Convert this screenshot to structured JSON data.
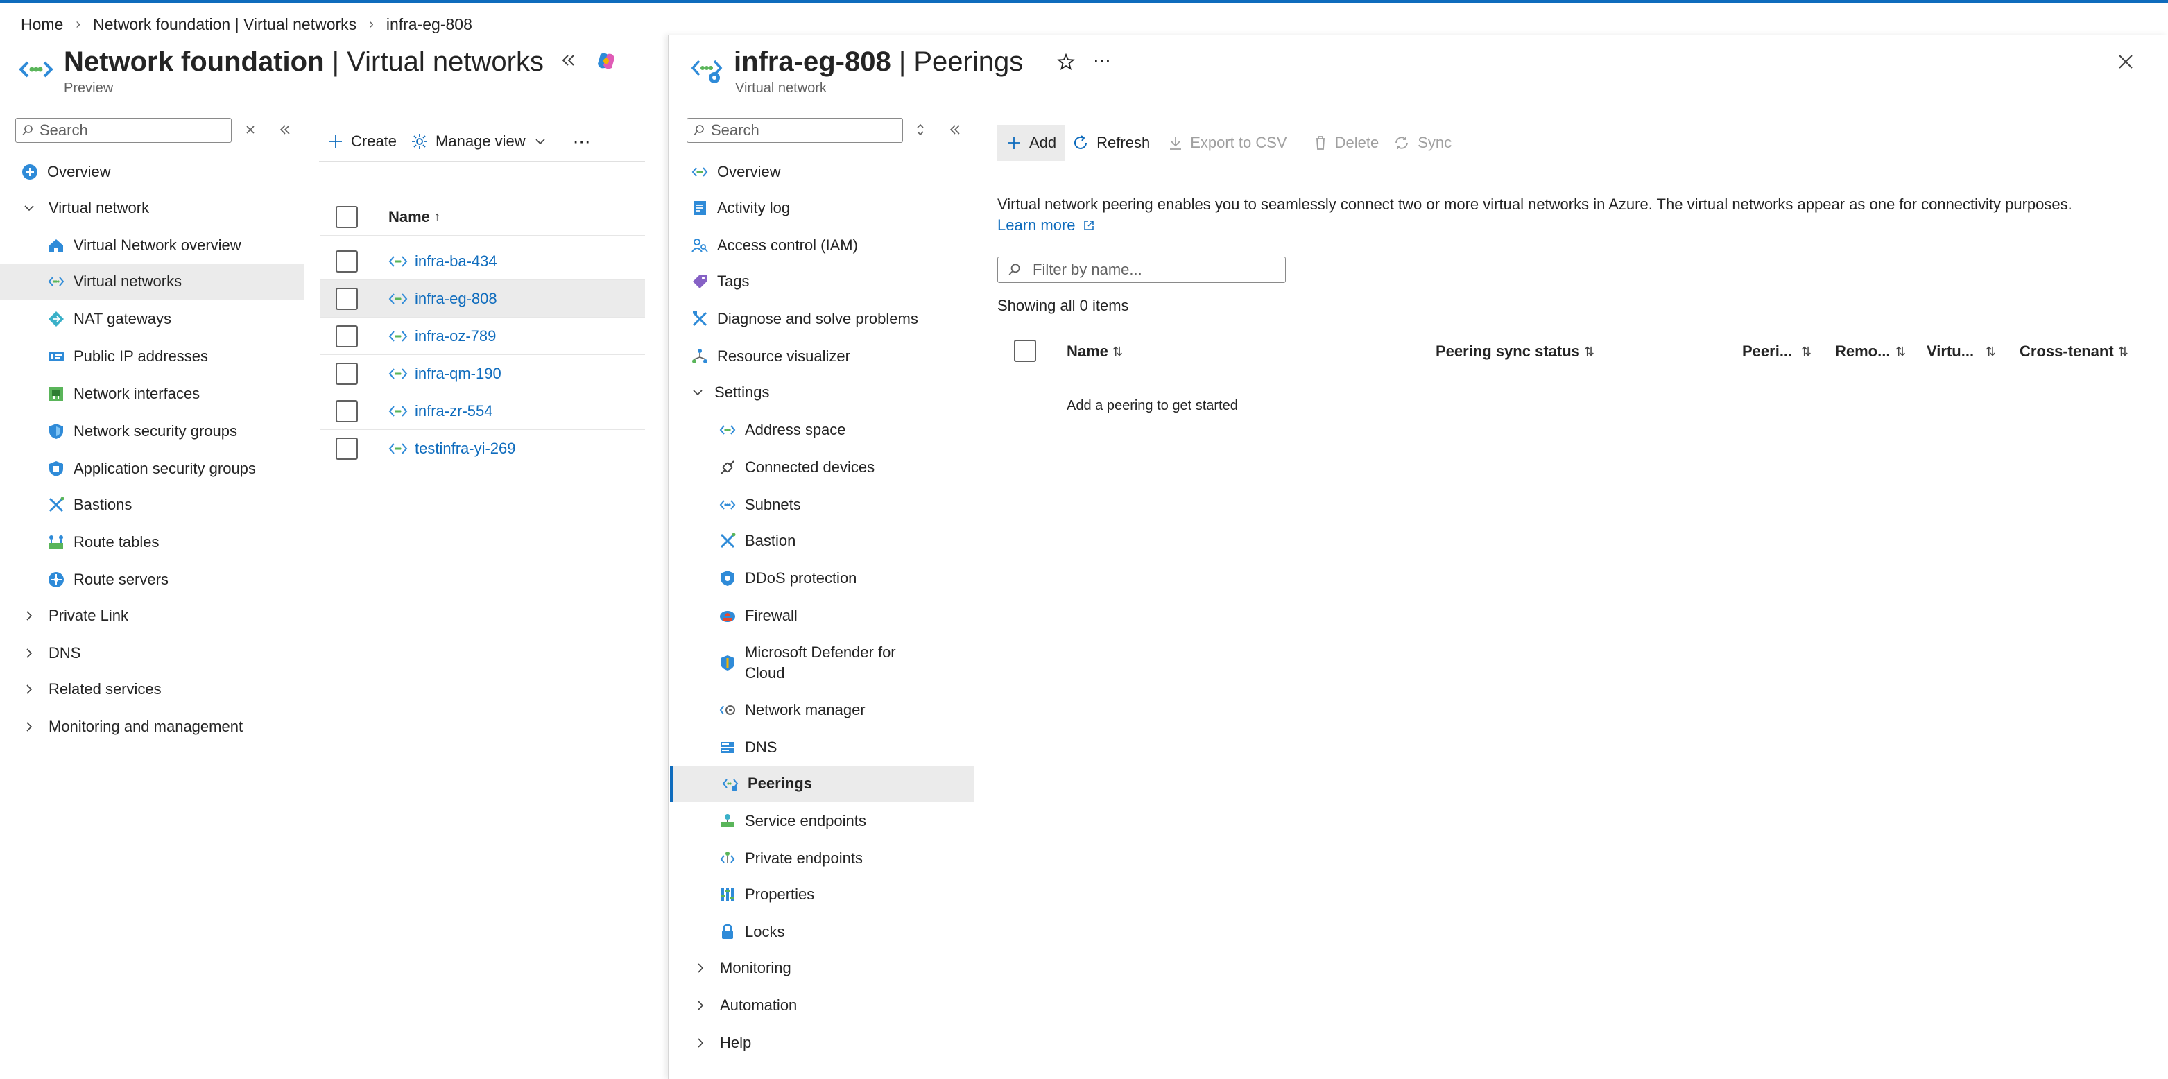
{
  "breadcrumb": {
    "items": [
      "Home",
      "Network foundation | Virtual networks",
      "infra-eg-808"
    ]
  },
  "left_blade": {
    "title_bold": "Network foundation",
    "title_rest": " | Virtual networks",
    "subtitle": "Preview",
    "search_placeholder": "Search",
    "nav": {
      "overview": "Overview",
      "virtual_network": "Virtual network",
      "vnet_overview": "Virtual Network overview",
      "virtual_networks": "Virtual networks",
      "nat_gateways": "NAT gateways",
      "public_ip": "Public IP addresses",
      "network_interfaces": "Network interfaces",
      "nsg": "Network security groups",
      "asg": "Application security groups",
      "bastions": "Bastions",
      "route_tables": "Route tables",
      "route_servers": "Route servers",
      "private_link": "Private Link",
      "dns": "DNS",
      "related_services": "Related services",
      "monitoring_management": "Monitoring and management"
    },
    "toolbar": {
      "create": "Create",
      "manage_view": "Manage view"
    },
    "grid": {
      "header_name": "Name",
      "sort_indicator": "↑",
      "rows": [
        "infra-ba-434",
        "infra-eg-808",
        "infra-oz-789",
        "infra-qm-190",
        "infra-zr-554",
        "testinfra-yi-269"
      ]
    }
  },
  "right_blade": {
    "title_bold": "infra-eg-808",
    "title_rest": " | Peerings",
    "subtitle": "Virtual network",
    "search_placeholder": "Search",
    "menu": {
      "overview": "Overview",
      "activity_log": "Activity log",
      "iam": "Access control (IAM)",
      "tags": "Tags",
      "diagnose": "Diagnose and solve problems",
      "resource_visualizer": "Resource visualizer",
      "settings": "Settings",
      "address_space": "Address space",
      "connected_devices": "Connected devices",
      "subnets": "Subnets",
      "bastion": "Bastion",
      "ddos": "DDoS protection",
      "firewall": "Firewall",
      "defender_line1": "Microsoft Defender for",
      "defender_line2": "Cloud",
      "network_manager": "Network manager",
      "dns": "DNS",
      "peerings": "Peerings",
      "service_endpoints": "Service endpoints",
      "private_endpoints": "Private endpoints",
      "properties": "Properties",
      "locks": "Locks",
      "monitoring": "Monitoring",
      "automation": "Automation",
      "help": "Help"
    },
    "toolbar": {
      "add": "Add",
      "refresh": "Refresh",
      "export": "Export to CSV",
      "delete": "Delete",
      "sync": "Sync"
    },
    "content": {
      "description": "Virtual network peering enables you to seamlessly connect two or more virtual networks in Azure. The virtual networks appear as one for connectivity purposes.",
      "learn_more": "Learn more",
      "filter_placeholder": "Filter by name...",
      "count": "Showing all 0 items",
      "columns": [
        "Name",
        "Peering sync status",
        "Peeri...",
        "Remo...",
        "Virtu...",
        "Cross-tenant"
      ],
      "empty": "Add a peering to get started"
    }
  },
  "colors": {
    "accent": "#0f6cbd",
    "link": "#0f6cbd",
    "selected_bg": "#ebebeb"
  }
}
